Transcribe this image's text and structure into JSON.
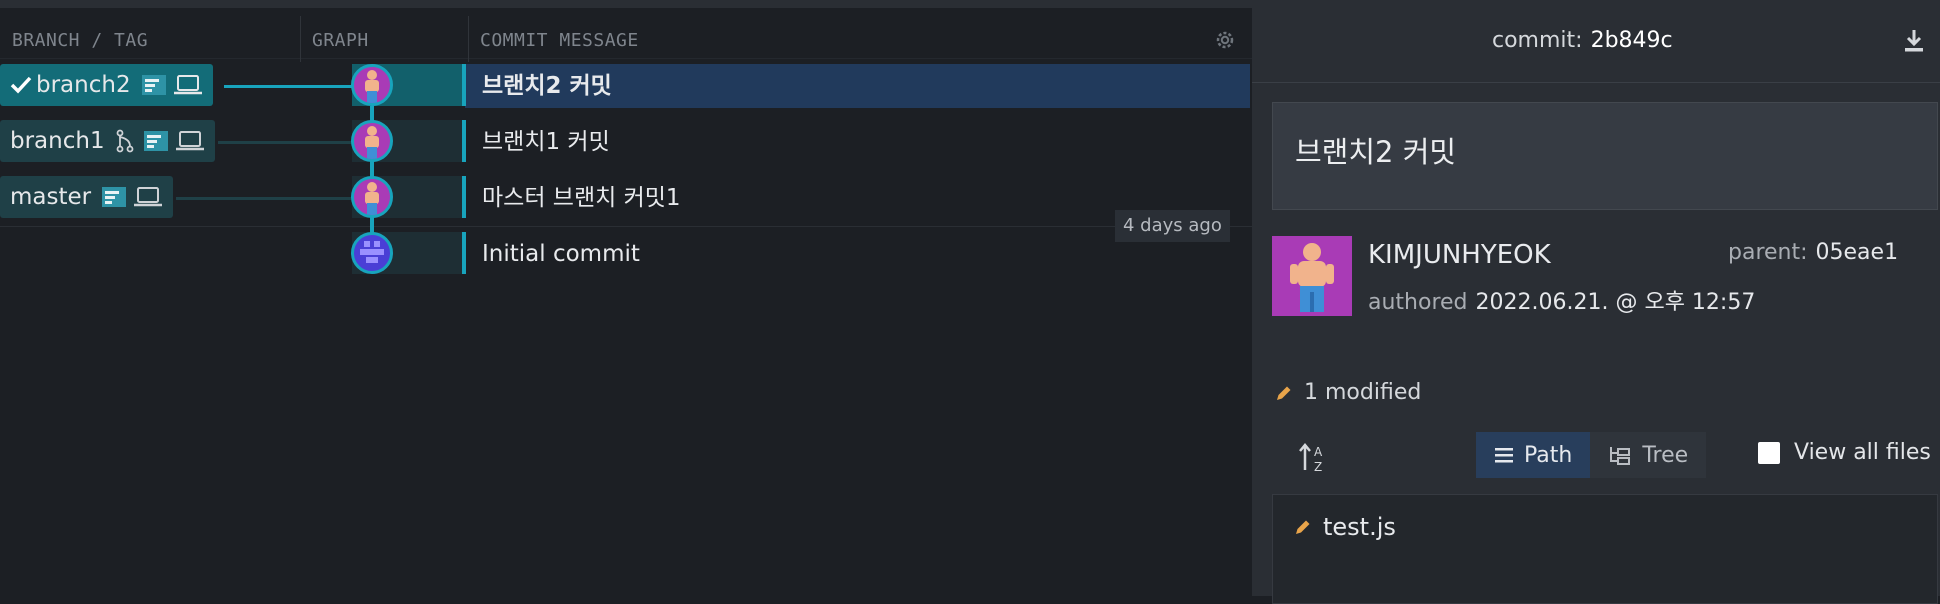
{
  "columns": {
    "branch_tag": "BRANCH / TAG",
    "graph": "GRAPH",
    "commit_message": "COMMIT MESSAGE"
  },
  "branches": [
    {
      "name": "branch2",
      "checked_out": true
    },
    {
      "name": "branch1",
      "checked_out": false
    },
    {
      "name": "master",
      "checked_out": false
    }
  ],
  "commits": [
    {
      "message": "브랜치2 커밋",
      "selected": true
    },
    {
      "message": "브랜치1 커밋",
      "selected": false
    },
    {
      "message": "마스터 브랜치 커밋1",
      "selected": false
    },
    {
      "message": "Initial commit",
      "selected": false
    }
  ],
  "relative_time": "4 days ago",
  "details": {
    "commit_label": "commit:",
    "commit_sha": "2b849c",
    "summary": "브랜치2 커밋",
    "author": "KIMJUNHYEOK",
    "authored_label": "authored",
    "authored_date": "2022.06.21. @ 오후 12:57",
    "parent_label": "parent:",
    "parent_sha": "05eae1",
    "modified": "1 modified",
    "view_path": "Path",
    "view_tree": "Tree",
    "view_all_files": "View all files",
    "files": [
      "test.js"
    ]
  },
  "colors": {
    "accent": "#18a4bd",
    "selected_row": "#213a5c",
    "branch_active": "#136c78",
    "avatar_bg": "#a93bb6",
    "modified_icon": "#e8a44a"
  },
  "icons": {
    "settings": "gear-icon",
    "download": "download-icon",
    "checkout": "check-icon",
    "remote": "monitor-icon",
    "local": "laptop-icon",
    "pr": "pull-request-icon",
    "edit": "pencil-icon",
    "sort": "sort-az-icon"
  }
}
